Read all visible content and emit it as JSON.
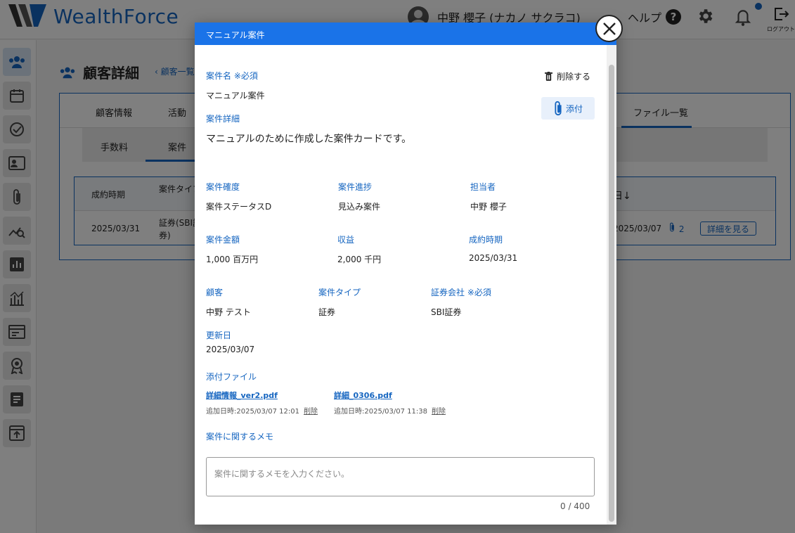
{
  "app": {
    "brand": "WealthForce",
    "user_name": "中野 櫻子 (ナカノ サクラコ)",
    "help_label": "ヘルプ",
    "logout_label": "ログアウト"
  },
  "page": {
    "title": "顧客詳細",
    "breadcrumb": "顧客一覧"
  },
  "tabs_primary": [
    "顧客情報",
    "活動",
    "ファイル一覧"
  ],
  "tabs_secondary": [
    "手数料",
    "案件"
  ],
  "table": {
    "headers": [
      "成約時期",
      "案件タイプ",
      "日↓"
    ],
    "row": {
      "date": "2025/03/31",
      "type_line1": "証券(SBI証",
      "type_line2": "券)",
      "updated": "2025/03/07",
      "attach_count": "2",
      "detail_button": "詳細を見る"
    }
  },
  "modal": {
    "title": "マニュアル案件",
    "delete_label": "削除する",
    "attach_label": "添付",
    "name_label": "案件名 ※必須",
    "name_value": "マニュアル案件",
    "detail_label": "案件詳細",
    "detail_value": "マニュアルのために作成した案件カードです。",
    "certainty_label": "案件確度",
    "certainty_value": "案件ステータスD",
    "progress_label": "案件進捗",
    "progress_value": "見込み案件",
    "owner_label": "担当者",
    "owner_value": "中野 櫻子",
    "amount_label": "案件金額",
    "amount_value": "1,000 百万円",
    "revenue_label": "収益",
    "revenue_value": "2,000 千円",
    "close_date_label": "成約時期",
    "close_date_value": "2025/03/31",
    "customer_label": "顧客",
    "customer_value": "中野 テスト",
    "type_label": "案件タイプ",
    "type_value": "証券",
    "company_label": "証券会社 ※必須",
    "company_value": "SBI証券",
    "updated_label": "更新日",
    "updated_value": "2025/03/07",
    "files_label": "添付ファイル",
    "files": [
      {
        "name": "詳細情報_ver2.pdf",
        "meta": "追加日時:2025/03/07 12:01",
        "delete": "削除"
      },
      {
        "name": "詳細_0306.pdf",
        "meta": "追加日時:2025/03/07 11:38",
        "delete": "削除"
      }
    ],
    "memo_label": "案件に関するメモ",
    "memo_placeholder": "案件に関するメモを入力ください。",
    "memo_counter": "0 / 400"
  },
  "colors": {
    "accent": "#1a73e8",
    "link": "#1565c0",
    "notification": "#1565c0"
  }
}
